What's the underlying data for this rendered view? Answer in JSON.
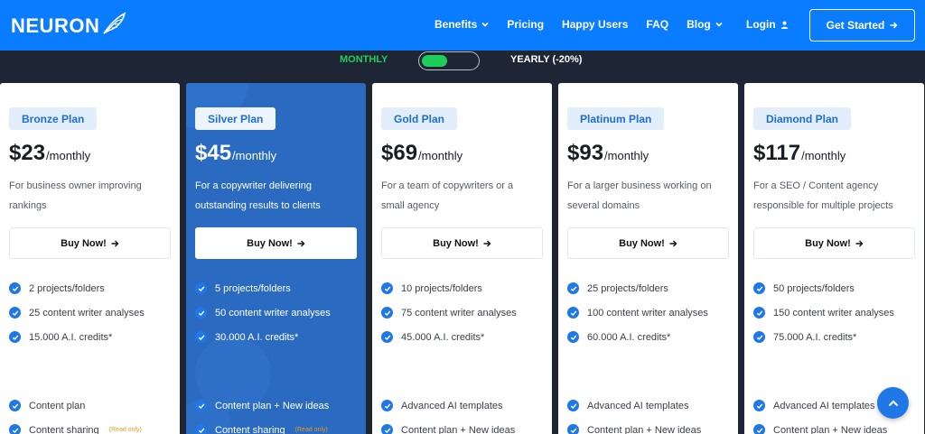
{
  "brand": {
    "name": "NEURON",
    "primary": "#0a7cff",
    "dark_bg": "#1e2535",
    "accent": "#1fce5a"
  },
  "nav": {
    "links": [
      {
        "label": "Benefits",
        "dropdown": true
      },
      {
        "label": "Pricing",
        "dropdown": false
      },
      {
        "label": "Happy Users",
        "dropdown": false
      },
      {
        "label": "FAQ",
        "dropdown": false
      },
      {
        "label": "Blog",
        "dropdown": true
      }
    ],
    "login": "Login",
    "cta": "Get Started"
  },
  "billing_toggle": {
    "monthly": "MONTHLY",
    "yearly": "YEARLY (-20%)",
    "selected": "monthly"
  },
  "plans": [
    {
      "name": "Bronze Plan",
      "price": "$23",
      "period": "/monthly",
      "description": "For business owner improving rankings",
      "button": "Buy Now!",
      "features": [
        "2 projects/folders",
        "25 content writer analyses",
        "15.000 A.I. credits*"
      ],
      "extras": [
        {
          "text": "Content plan",
          "note": ""
        },
        {
          "text": "Content sharing",
          "note": "(Read only)"
        }
      ]
    },
    {
      "name": "Silver Plan",
      "price": "$45",
      "period": "/monthly",
      "description": "For a copywriter delivering outstanding results to clients",
      "button": "Buy Now!",
      "features": [
        "5 projects/folders",
        "50 content writer analyses",
        "30.000 A.I. credits*"
      ],
      "extras": [
        {
          "text": "Content plan + New ideas",
          "note": ""
        },
        {
          "text": "Content sharing",
          "note": "(Read only)"
        }
      ]
    },
    {
      "name": "Gold Plan",
      "price": "$69",
      "period": "/monthly",
      "description": "For a team of copywriters or a small agency",
      "button": "Buy Now!",
      "features": [
        "10 projects/folders",
        "75 content writer analyses",
        "45.000 A.I. credits*"
      ],
      "extras": [
        {
          "text": "Advanced AI templates",
          "note": ""
        },
        {
          "text": "Content plan + New ideas",
          "note": ""
        }
      ]
    },
    {
      "name": "Platinum Plan",
      "price": "$93",
      "period": "/monthly",
      "description": "For a larger business working on several domains",
      "button": "Buy Now!",
      "features": [
        "25 projects/folders",
        "100 content writer analyses",
        "60.000 A.I. credits*"
      ],
      "extras": [
        {
          "text": "Advanced AI templates",
          "note": ""
        },
        {
          "text": "Content plan + New ideas",
          "note": ""
        }
      ]
    },
    {
      "name": "Diamond Plan",
      "price": "$117",
      "period": "/monthly",
      "description": "For a SEO / Content agency responsible for multiple projects",
      "button": "Buy Now!",
      "features": [
        "50 projects/folders",
        "150 content writer analyses",
        "75.000 A.I. credits*"
      ],
      "extras": [
        {
          "text": "Advanced AI templates",
          "note": ""
        },
        {
          "text": "Content plan + New ideas",
          "note": ""
        }
      ]
    }
  ]
}
